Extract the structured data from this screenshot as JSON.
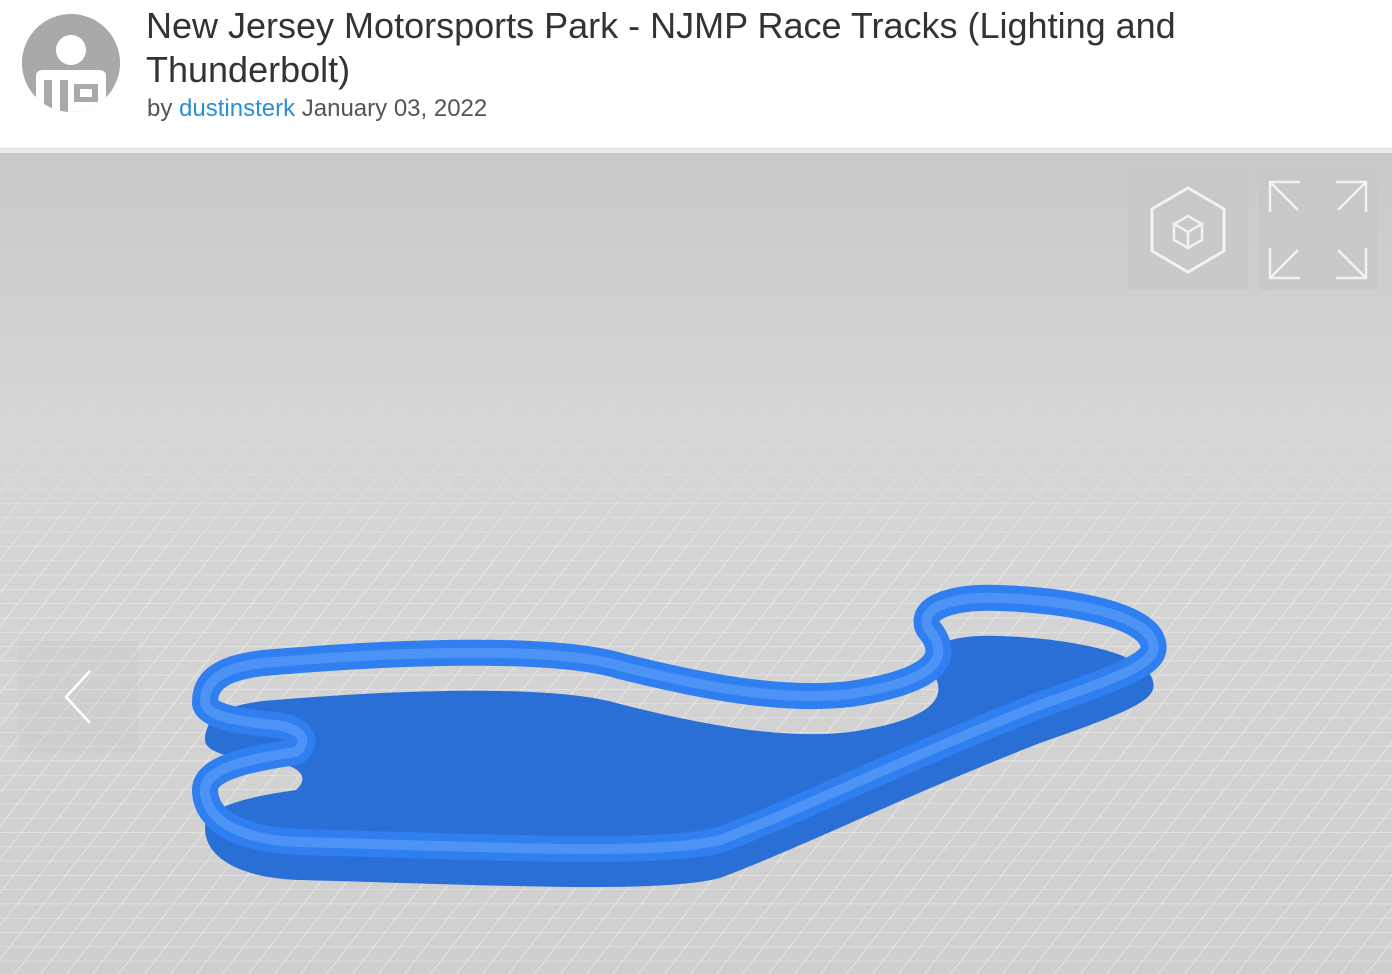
{
  "thing": {
    "title": "New Jersey Motorsports Park - NJMP Race Tracks (Lighting and Thunderbolt)",
    "by_label": "by",
    "author": "dustinsterk",
    "date": "January 03, 2022"
  },
  "viewer": {
    "model_color": "#2f7ff0",
    "controls": [
      {
        "name": "3d-view-toggle",
        "icon": "cube-icon"
      },
      {
        "name": "fullscreen",
        "icon": "expand-icon"
      }
    ],
    "nav": {
      "prev_icon": "chevron-left-icon"
    }
  }
}
